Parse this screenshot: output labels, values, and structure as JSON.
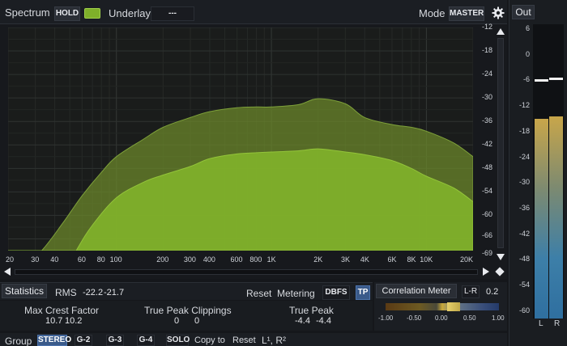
{
  "header": {
    "spectrum_label": "Spectrum",
    "hold_label": "HOLD",
    "underlay_label": "Underlay",
    "underlay_value": "---",
    "mode_label": "Mode",
    "mode_value": "MASTER"
  },
  "out": {
    "label": "Out",
    "scale": [
      "6",
      "0",
      "-6",
      "-12",
      "-18",
      "-24",
      "-30",
      "-36",
      "-42",
      "-48",
      "-54",
      "-60"
    ],
    "channels": [
      "L",
      "R"
    ],
    "level_left_db": -15,
    "level_right_db": -14.5,
    "peak_left_db": -6,
    "peak_right_db": -5.5
  },
  "spectrum": {
    "db_ticks": [
      "-12",
      "-18",
      "-24",
      "-30",
      "-36",
      "-42",
      "-48",
      "-54",
      "-60",
      "-66",
      "-69"
    ],
    "freq_ticks": [
      "20",
      "30",
      "40",
      "60",
      "80",
      "100",
      "200",
      "300",
      "400",
      "600",
      "800",
      "1K",
      "2K",
      "3K",
      "4K",
      "6K",
      "8K",
      "10K",
      "20K"
    ],
    "colors": {
      "hold": "#6d8b2b",
      "live": "#7fb02a",
      "background": "#1a1c1b"
    }
  },
  "chart_data": {
    "type": "area",
    "xscale": "log",
    "ylim": [
      -69,
      -12
    ],
    "series": [
      {
        "x": [
          20,
          33,
          45,
          60,
          80,
          100,
          150,
          200,
          300,
          400,
          600,
          800,
          1000,
          1500,
          2000,
          3000,
          4000,
          6000,
          8000,
          10000,
          15000,
          20000
        ],
        "values": [
          -78,
          -69,
          -62,
          -55,
          -49,
          -45,
          -40.5,
          -37.5,
          -35,
          -33.5,
          -32.5,
          -32.3,
          -32.3,
          -31.7,
          -30.2,
          -31.5,
          -35,
          -36.8,
          -37.5,
          -38.5,
          -41.5,
          -45
        ]
      },
      {
        "x": [
          20,
          40,
          55,
          70,
          100,
          150,
          200,
          300,
          400,
          600,
          800,
          1000,
          1500,
          2000,
          3000,
          4000,
          6000,
          8000,
          10000,
          15000,
          20000
        ],
        "values": [
          -90,
          -79,
          -69,
          -62.5,
          -55.5,
          -51.5,
          -49.7,
          -47.5,
          -45.5,
          -44.3,
          -44,
          -43.8,
          -43.5,
          -43,
          -43.8,
          -44.5,
          -46,
          -48,
          -50,
          -53,
          -56.5
        ]
      }
    ]
  },
  "statistics": {
    "label": "Statistics",
    "rms_label": "RMS",
    "rms_left": "-22.2",
    "rms_right": "-21.7",
    "reset_label": "Reset",
    "metering_label": "Metering",
    "dbfs_label": "DBFS",
    "tp_label": "TP",
    "crest_label": "Max Crest Factor",
    "crest_left": "10.7",
    "crest_right": "10.2",
    "clip_label": "True Peak Clippings",
    "clip_left": "0",
    "clip_right": "0",
    "tp_value_label": "True Peak",
    "tp_left": "-4.4",
    "tp_right": "-4.4"
  },
  "correlation": {
    "label": "Correlation Meter",
    "mode": "L-R",
    "value": "0.2",
    "ticks": [
      "-1.00",
      "-0.50",
      "0.00",
      "0.50",
      "1.00"
    ]
  },
  "group": {
    "label": "Group",
    "buttons": [
      "STEREO",
      "G-2",
      "G-3",
      "G-4",
      "SOLO"
    ],
    "copy_label": "Copy to",
    "reset_label": "Reset",
    "channel_text": "L¹, R²"
  }
}
